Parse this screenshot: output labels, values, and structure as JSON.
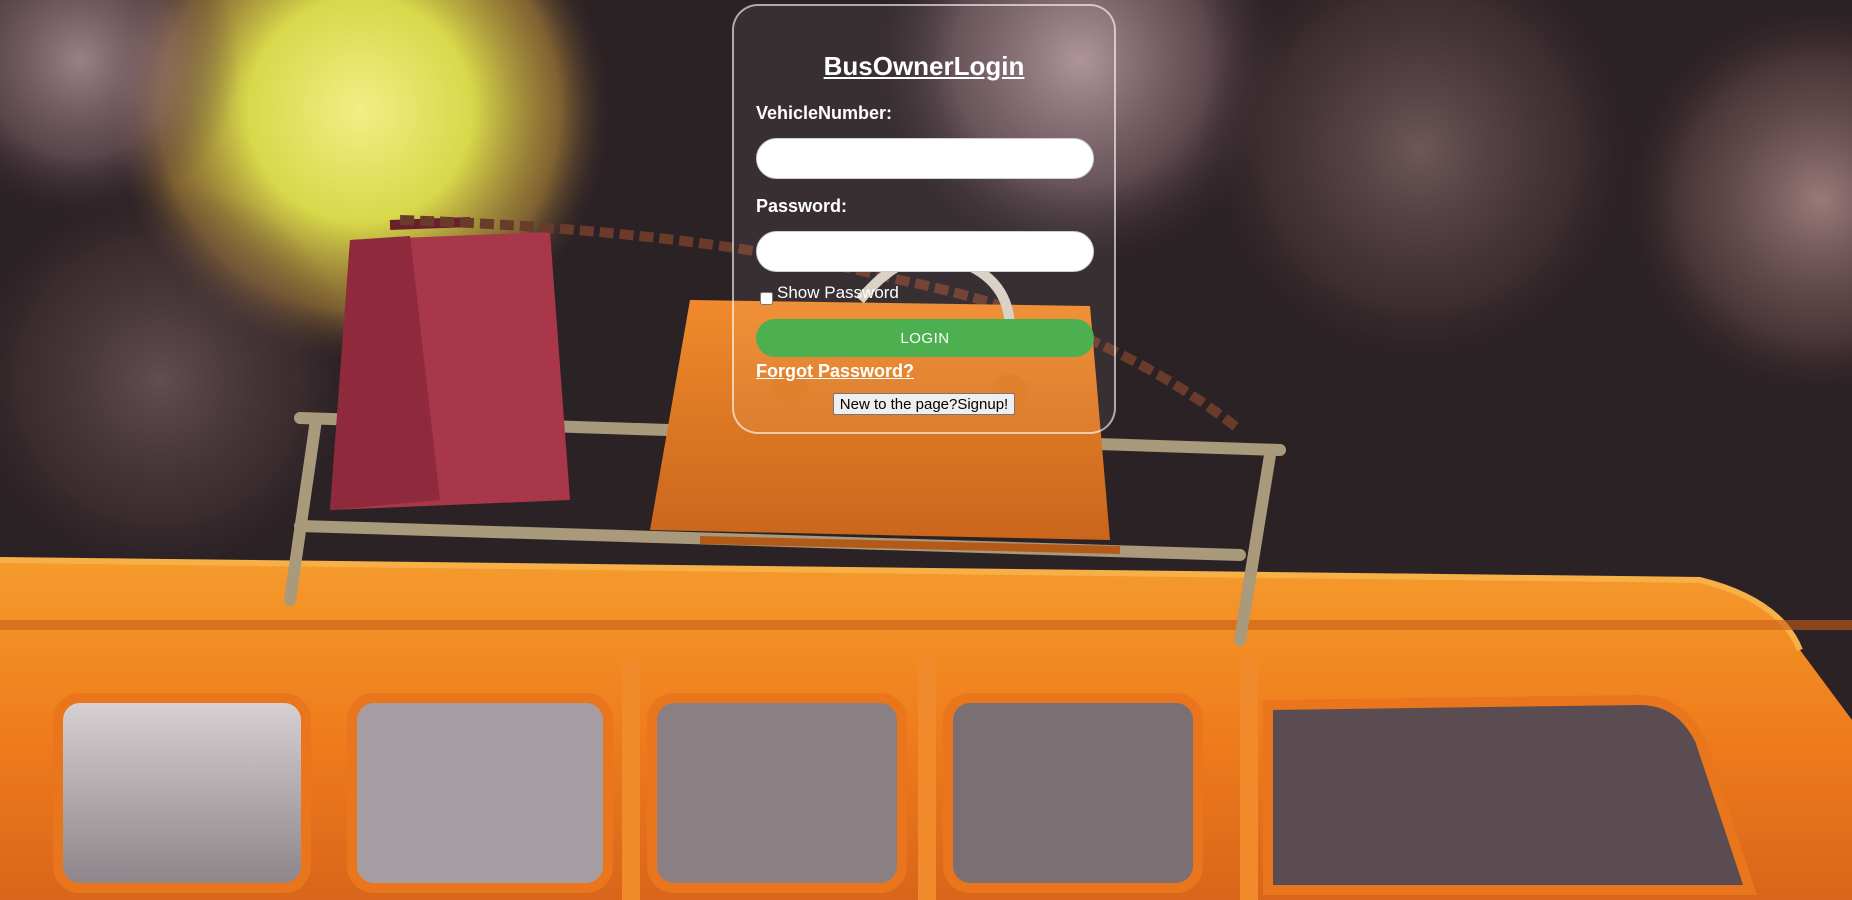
{
  "login": {
    "title": "BusOwnerLogin",
    "vehicle_label": "VehicleNumber:",
    "vehicle_value": "",
    "password_label": "Password:",
    "password_value": "",
    "show_password_label": "Show Password",
    "show_password_checked": false,
    "login_button": "LOGIN",
    "forgot_link": "Forgot Password?",
    "signup_button": "New to the page?Signup!"
  },
  "colors": {
    "login_button": "#4caf50",
    "bus_body": "#f07a1e",
    "card_border": "#ffffff"
  },
  "background": {
    "icon": "toy-bus-photo"
  }
}
